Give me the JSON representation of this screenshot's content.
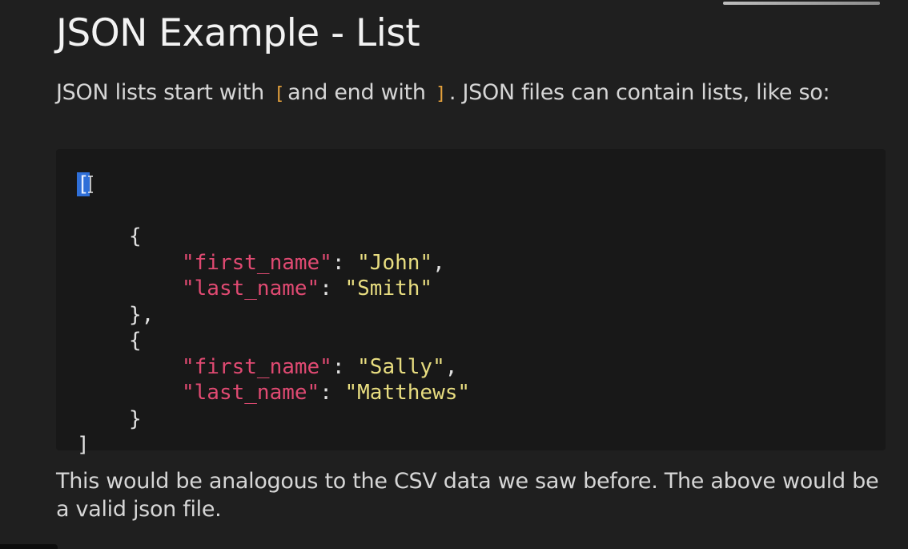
{
  "document": {
    "title": "JSON Example - List",
    "intro": {
      "text_before": "JSON lists start with",
      "open_bracket": "[",
      "text_middle": "and end with",
      "close_bracket": "]",
      "text_after": ". JSON files can contain lists, like so:"
    },
    "code": {
      "lines": [
        {
          "open": "["
        },
        {
          "brace": "{"
        },
        {
          "key": "\"first_name\"",
          "sep": ": ",
          "value": "\"John\"",
          "trail": ","
        },
        {
          "key": "\"last_name\"",
          "sep": ": ",
          "value": "\"Smith\""
        },
        {
          "brace": "},"
        },
        {
          "brace": "{"
        },
        {
          "key": "\"first_name\"",
          "sep": ": ",
          "value": "\"Sally\"",
          "trail": ","
        },
        {
          "key": "\"last_name\"",
          "sep": ": ",
          "value": "\"Matthews\""
        },
        {
          "brace": "}"
        },
        {
          "close": "]"
        }
      ]
    },
    "outro": "This would be analogous to the CSV data we saw before. The above would be a valid json file."
  },
  "colors": {
    "background": "#1f1f1f",
    "code_background": "#181818",
    "json_key": "#e04a72",
    "json_string": "#e8dd80",
    "inline_code": "#e6a23c",
    "selection": "#2f6fd8"
  }
}
